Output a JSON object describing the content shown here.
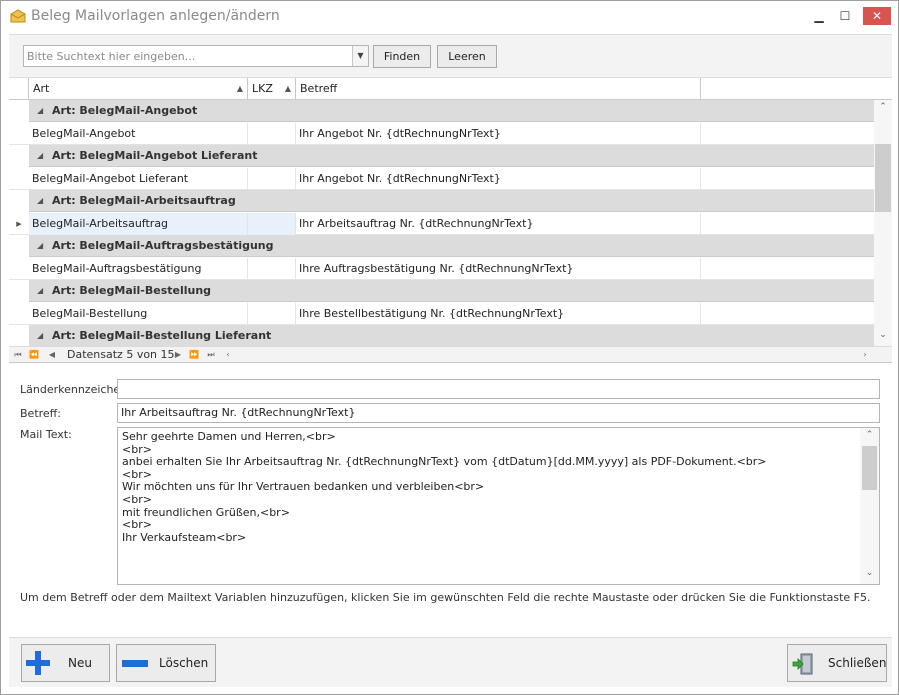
{
  "window": {
    "title": "Beleg Mailvorlagen anlegen/ändern",
    "controls": {
      "minimize": "▁",
      "maximize": "☐",
      "close": "✕"
    }
  },
  "search": {
    "placeholder": "Bitte Suchtext hier eingeben...",
    "value": "",
    "find_label": "Finden",
    "clear_label": "Leeren"
  },
  "grid": {
    "columns": {
      "art": "Art",
      "lkz": "LKZ",
      "betreff": "Betreff"
    },
    "rows": [
      {
        "group": "Art: BelegMail-Angebot"
      },
      {
        "art": "BelegMail-Angebot",
        "lkz": "",
        "betreff": "Ihr Angebot Nr. {dtRechnungNrText}"
      },
      {
        "group": "Art: BelegMail-Angebot Lieferant"
      },
      {
        "art": "BelegMail-Angebot Lieferant",
        "lkz": "",
        "betreff": "Ihr Angebot Nr. {dtRechnungNrText}"
      },
      {
        "group": "Art: BelegMail-Arbeitsauftrag"
      },
      {
        "art": "BelegMail-Arbeitsauftrag",
        "lkz": "",
        "betreff": "Ihr Arbeitsauftrag Nr. {dtRechnungNrText}",
        "selected": true
      },
      {
        "group": "Art: BelegMail-Auftragsbestätigung"
      },
      {
        "art": "BelegMail-Auftragsbestätigung",
        "lkz": "",
        "betreff": "Ihre Auftragsbestätigung Nr. {dtRechnungNrText}"
      },
      {
        "group": "Art: BelegMail-Bestellung"
      },
      {
        "art": "BelegMail-Bestellung",
        "lkz": "",
        "betreff": "Ihre Bestellbestätigung Nr. {dtRechnungNrText}"
      },
      {
        "group": "Art: BelegMail-Bestellung Lieferant"
      }
    ],
    "navigator_text": "Datensatz 5 von 15"
  },
  "detail": {
    "laenderkennzeichen_label": "Länderkennzeichen",
    "laenderkennzeichen_value": "",
    "betreff_label": "Betreff:",
    "betreff_value": "Ihr Arbeitsauftrag Nr. {dtRechnungNrText}",
    "mailtext_label": "Mail Text:",
    "mailtext_lines": [
      "Sehr geehrte Damen und Herren,<br>",
      "<br>",
      "anbei erhalten Sie Ihr Arbeitsauftrag Nr. {dtRechnungNrText} vom {dtDatum}[dd.MM.yyyy] als PDF-Dokument.<br>",
      "<br>",
      "Wir möchten uns für Ihr Vertrauen bedanken und verbleiben<br>",
      "<br>",
      "mit freundlichen Grüßen,<br>",
      "<br>",
      "Ihr Verkaufsteam<br>"
    ],
    "hint": "Um dem Betreff oder dem Mailtext Variablen hinzuzufügen, klicken Sie im gewünschten Feld die rechte Maustaste oder drücken Sie die Funktionstaste F5."
  },
  "buttons": {
    "new_label": "Neu",
    "delete_label": "Löschen",
    "close_label": "Schließen"
  },
  "colors": {
    "accent_blue": "#1e6ed6",
    "group_bg": "#dcdcdc",
    "selected_bg": "#e8f1fb",
    "close_red": "#d9534f"
  },
  "icons": {
    "title": "mail-template-icon",
    "new": "plus-icon",
    "delete": "minus-icon",
    "close": "exit-door-icon"
  }
}
